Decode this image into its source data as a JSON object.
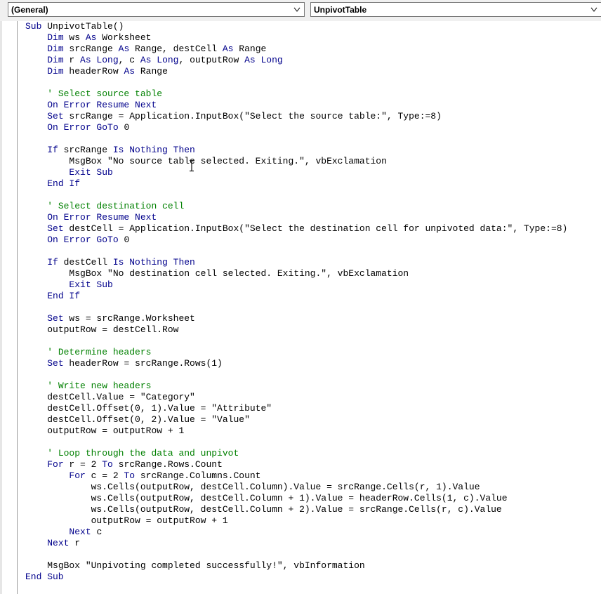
{
  "object_combo": {
    "value": "(General)"
  },
  "procedure_combo": {
    "value": "UnpivotTable"
  },
  "colors": {
    "keyword": "#00008b",
    "comment": "#008000",
    "text": "#000000"
  },
  "icons": {
    "dropdown": "chevron-down-icon",
    "cursor": "text-cursor-icon"
  },
  "code": {
    "lines": [
      {
        "indent": "",
        "tokens": [
          {
            "t": "kw",
            "v": "Sub"
          },
          {
            "t": "tx",
            "v": " UnpivotTable()"
          }
        ]
      },
      {
        "indent": "    ",
        "tokens": [
          {
            "t": "kw",
            "v": "Dim"
          },
          {
            "t": "tx",
            "v": " ws "
          },
          {
            "t": "kw",
            "v": "As"
          },
          {
            "t": "tx",
            "v": " Worksheet"
          }
        ]
      },
      {
        "indent": "    ",
        "tokens": [
          {
            "t": "kw",
            "v": "Dim"
          },
          {
            "t": "tx",
            "v": " srcRange "
          },
          {
            "t": "kw",
            "v": "As"
          },
          {
            "t": "tx",
            "v": " Range, destCell "
          },
          {
            "t": "kw",
            "v": "As"
          },
          {
            "t": "tx",
            "v": " Range"
          }
        ]
      },
      {
        "indent": "    ",
        "tokens": [
          {
            "t": "kw",
            "v": "Dim"
          },
          {
            "t": "tx",
            "v": " r "
          },
          {
            "t": "kw",
            "v": "As Long"
          },
          {
            "t": "tx",
            "v": ", c "
          },
          {
            "t": "kw",
            "v": "As Long"
          },
          {
            "t": "tx",
            "v": ", outputRow "
          },
          {
            "t": "kw",
            "v": "As Long"
          }
        ]
      },
      {
        "indent": "    ",
        "tokens": [
          {
            "t": "kw",
            "v": "Dim"
          },
          {
            "t": "tx",
            "v": " headerRow "
          },
          {
            "t": "kw",
            "v": "As"
          },
          {
            "t": "tx",
            "v": " Range"
          }
        ]
      },
      {
        "indent": "",
        "tokens": []
      },
      {
        "indent": "    ",
        "tokens": [
          {
            "t": "cm",
            "v": "' Select source table"
          }
        ]
      },
      {
        "indent": "    ",
        "tokens": [
          {
            "t": "kw",
            "v": "On Error Resume Next"
          }
        ]
      },
      {
        "indent": "    ",
        "tokens": [
          {
            "t": "kw",
            "v": "Set"
          },
          {
            "t": "tx",
            "v": " srcRange = Application.InputBox(\"Select the source table:\", Type:=8)"
          }
        ]
      },
      {
        "indent": "    ",
        "tokens": [
          {
            "t": "kw",
            "v": "On Error GoTo"
          },
          {
            "t": "tx",
            "v": " 0"
          }
        ]
      },
      {
        "indent": "",
        "tokens": []
      },
      {
        "indent": "    ",
        "tokens": [
          {
            "t": "kw",
            "v": "If"
          },
          {
            "t": "tx",
            "v": " srcRange "
          },
          {
            "t": "kw",
            "v": "Is Nothing Then"
          }
        ]
      },
      {
        "indent": "        ",
        "tokens": [
          {
            "t": "tx",
            "v": "MsgBox \"No source table selected. Exiting.\", vbExclamation"
          }
        ]
      },
      {
        "indent": "        ",
        "tokens": [
          {
            "t": "kw",
            "v": "Exit Sub"
          }
        ]
      },
      {
        "indent": "    ",
        "tokens": [
          {
            "t": "kw",
            "v": "End If"
          }
        ]
      },
      {
        "indent": "",
        "tokens": []
      },
      {
        "indent": "    ",
        "tokens": [
          {
            "t": "cm",
            "v": "' Select destination cell"
          }
        ]
      },
      {
        "indent": "    ",
        "tokens": [
          {
            "t": "kw",
            "v": "On Error Resume Next"
          }
        ]
      },
      {
        "indent": "    ",
        "tokens": [
          {
            "t": "kw",
            "v": "Set"
          },
          {
            "t": "tx",
            "v": " destCell = Application.InputBox(\"Select the destination cell for unpivoted data:\", Type:=8)"
          }
        ]
      },
      {
        "indent": "    ",
        "tokens": [
          {
            "t": "kw",
            "v": "On Error GoTo"
          },
          {
            "t": "tx",
            "v": " 0"
          }
        ]
      },
      {
        "indent": "",
        "tokens": []
      },
      {
        "indent": "    ",
        "tokens": [
          {
            "t": "kw",
            "v": "If"
          },
          {
            "t": "tx",
            "v": " destCell "
          },
          {
            "t": "kw",
            "v": "Is Nothing Then"
          }
        ]
      },
      {
        "indent": "        ",
        "tokens": [
          {
            "t": "tx",
            "v": "MsgBox \"No destination cell selected. Exiting.\", vbExclamation"
          }
        ]
      },
      {
        "indent": "        ",
        "tokens": [
          {
            "t": "kw",
            "v": "Exit Sub"
          }
        ]
      },
      {
        "indent": "    ",
        "tokens": [
          {
            "t": "kw",
            "v": "End If"
          }
        ]
      },
      {
        "indent": "",
        "tokens": []
      },
      {
        "indent": "    ",
        "tokens": [
          {
            "t": "kw",
            "v": "Set"
          },
          {
            "t": "tx",
            "v": " ws = srcRange.Worksheet"
          }
        ]
      },
      {
        "indent": "    ",
        "tokens": [
          {
            "t": "tx",
            "v": "outputRow = destCell.Row"
          }
        ]
      },
      {
        "indent": "",
        "tokens": []
      },
      {
        "indent": "    ",
        "tokens": [
          {
            "t": "cm",
            "v": "' Determine headers"
          }
        ]
      },
      {
        "indent": "    ",
        "tokens": [
          {
            "t": "kw",
            "v": "Set"
          },
          {
            "t": "tx",
            "v": " headerRow = srcRange.Rows(1)"
          }
        ]
      },
      {
        "indent": "",
        "tokens": []
      },
      {
        "indent": "    ",
        "tokens": [
          {
            "t": "cm",
            "v": "' Write new headers"
          }
        ]
      },
      {
        "indent": "    ",
        "tokens": [
          {
            "t": "tx",
            "v": "destCell.Value = \"Category\""
          }
        ]
      },
      {
        "indent": "    ",
        "tokens": [
          {
            "t": "tx",
            "v": "destCell.Offset(0, 1).Value = \"Attribute\""
          }
        ]
      },
      {
        "indent": "    ",
        "tokens": [
          {
            "t": "tx",
            "v": "destCell.Offset(0, 2).Value = \"Value\""
          }
        ]
      },
      {
        "indent": "    ",
        "tokens": [
          {
            "t": "tx",
            "v": "outputRow = outputRow + 1"
          }
        ]
      },
      {
        "indent": "",
        "tokens": []
      },
      {
        "indent": "    ",
        "tokens": [
          {
            "t": "cm",
            "v": "' Loop through the data and unpivot"
          }
        ]
      },
      {
        "indent": "    ",
        "tokens": [
          {
            "t": "kw",
            "v": "For"
          },
          {
            "t": "tx",
            "v": " r = 2 "
          },
          {
            "t": "kw",
            "v": "To"
          },
          {
            "t": "tx",
            "v": " srcRange.Rows.Count"
          }
        ]
      },
      {
        "indent": "        ",
        "tokens": [
          {
            "t": "kw",
            "v": "For"
          },
          {
            "t": "tx",
            "v": " c = 2 "
          },
          {
            "t": "kw",
            "v": "To"
          },
          {
            "t": "tx",
            "v": " srcRange.Columns.Count"
          }
        ]
      },
      {
        "indent": "            ",
        "tokens": [
          {
            "t": "tx",
            "v": "ws.Cells(outputRow, destCell.Column).Value = srcRange.Cells(r, 1).Value"
          }
        ]
      },
      {
        "indent": "            ",
        "tokens": [
          {
            "t": "tx",
            "v": "ws.Cells(outputRow, destCell.Column + 1).Value = headerRow.Cells(1, c).Value"
          }
        ]
      },
      {
        "indent": "            ",
        "tokens": [
          {
            "t": "tx",
            "v": "ws.Cells(outputRow, destCell.Column + 2).Value = srcRange.Cells(r, c).Value"
          }
        ]
      },
      {
        "indent": "            ",
        "tokens": [
          {
            "t": "tx",
            "v": "outputRow = outputRow + 1"
          }
        ]
      },
      {
        "indent": "        ",
        "tokens": [
          {
            "t": "kw",
            "v": "Next"
          },
          {
            "t": "tx",
            "v": " c"
          }
        ]
      },
      {
        "indent": "    ",
        "tokens": [
          {
            "t": "kw",
            "v": "Next"
          },
          {
            "t": "tx",
            "v": " r"
          }
        ]
      },
      {
        "indent": "",
        "tokens": []
      },
      {
        "indent": "    ",
        "tokens": [
          {
            "t": "tx",
            "v": "MsgBox \"Unpivoting completed successfully!\", vbInformation"
          }
        ]
      },
      {
        "indent": "",
        "tokens": [
          {
            "t": "kw",
            "v": "End Sub"
          }
        ]
      }
    ]
  }
}
